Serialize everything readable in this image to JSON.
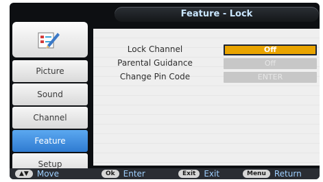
{
  "title": "Feature - Lock",
  "sidebar": {
    "items": [
      {
        "label": "Picture"
      },
      {
        "label": "Sound"
      },
      {
        "label": "Channel"
      },
      {
        "label": "Feature",
        "active": true
      },
      {
        "label": "Setup"
      }
    ]
  },
  "menu": {
    "rows": [
      {
        "label": "Lock Channel",
        "value": "Off",
        "state": "selected"
      },
      {
        "label": "Parental Guidance",
        "value": "Off",
        "state": "disabled"
      },
      {
        "label": "Change Pin Code",
        "value": "ENTER",
        "state": "disabled"
      }
    ]
  },
  "hints": [
    {
      "key": "▲▼",
      "action": "Move"
    },
    {
      "key": "Ok",
      "action": "Enter"
    },
    {
      "key": "Exit",
      "action": "Exit"
    },
    {
      "key": "Menu",
      "action": "Return"
    }
  ],
  "colors": {
    "accent_active": "#2f7bd1",
    "selection": "#e9a400",
    "title_text": "#c9e6ff"
  }
}
